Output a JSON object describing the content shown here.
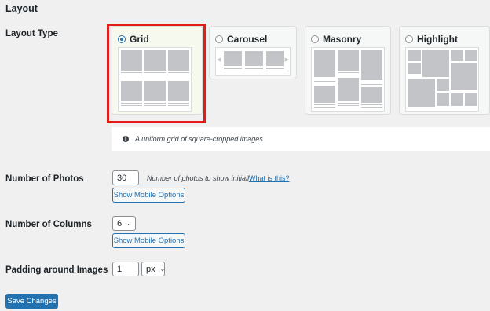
{
  "section_title": "Layout",
  "layout_type": {
    "label": "Layout Type",
    "options": [
      {
        "label": "Grid",
        "selected": true
      },
      {
        "label": "Carousel",
        "selected": false
      },
      {
        "label": "Masonry",
        "selected": false
      },
      {
        "label": "Highlight",
        "selected": false
      }
    ],
    "description": "A uniform grid of square-cropped images.",
    "info_icon": "info-icon"
  },
  "number_of_photos": {
    "label": "Number of Photos",
    "value": "30",
    "hint": "Number of photos to show initially",
    "help_link": "What is this?",
    "mobile_button": "Show Mobile Options"
  },
  "number_of_columns": {
    "label": "Number of Columns",
    "value": "6",
    "mobile_button": "Show Mobile Options"
  },
  "padding": {
    "label": "Padding around Images",
    "value": "1",
    "unit": "px"
  },
  "save_button": "Save Changes",
  "colors": {
    "accent": "#2271b1",
    "selection_outline": "#e41b1b",
    "background": "#f0f0f1"
  }
}
